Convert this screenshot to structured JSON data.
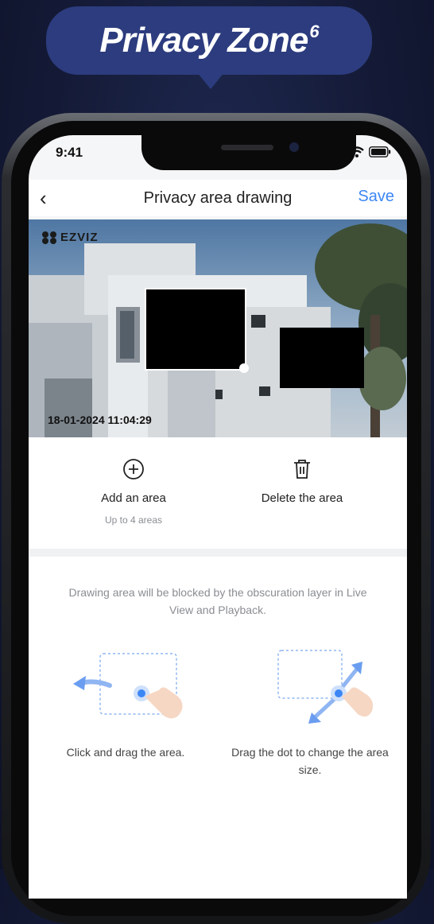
{
  "banner": {
    "title": "Privacy Zone",
    "superscript": "6"
  },
  "status": {
    "time": "9:41"
  },
  "nav": {
    "back": "‹",
    "title": "Privacy area drawing",
    "save": "Save"
  },
  "camera": {
    "brand": "EZVIZ",
    "timestamp": "18-01-2024 11:04:29"
  },
  "actions": {
    "add": {
      "label": "Add an area",
      "sub": "Up to 4 areas"
    },
    "delete": {
      "label": "Delete the area"
    }
  },
  "guide": {
    "text": "Drawing area will be blocked by the obscuration layer in Live View and Playback.",
    "tip1": "Click and drag the area.",
    "tip2": "Drag the dot to change the area size."
  },
  "colors": {
    "accent": "#3d87f5",
    "banner": "#2c3c7e"
  },
  "icons": [
    "back-icon",
    "signal-icon",
    "wifi-icon",
    "battery-icon",
    "add-circle-icon",
    "trash-icon",
    "drag-hand-icon",
    "resize-hand-icon"
  ]
}
